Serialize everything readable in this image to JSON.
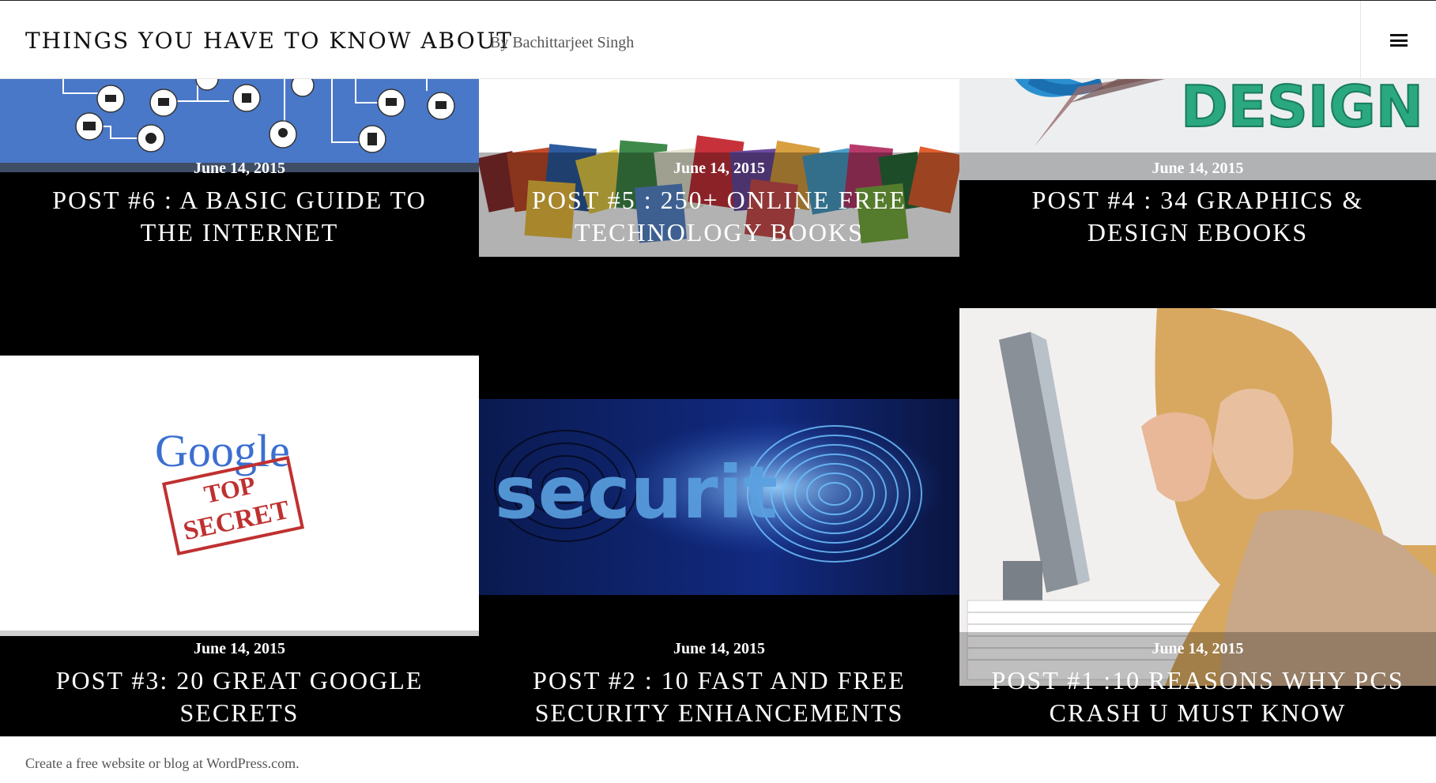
{
  "header": {
    "site_title": "THINGS YOU HAVE TO KNOW ABOUT",
    "site_description": "By Bachittarjeet Singh",
    "menu_icon": "hamburger-menu-icon"
  },
  "posts": [
    {
      "date": "June 14, 2015",
      "title": "POST #6 : A BASIC GUIDE TO THE INTERNET",
      "thumbnail": "internet-devices-illustration"
    },
    {
      "date": "June 14, 2015",
      "title": "POST #5 : 250+ ONLINE FREE TECHNOLOGY BOOKS",
      "thumbnail": "pile-of-books-image"
    },
    {
      "date": "June 14, 2015",
      "title": "POST #4 : 34 GRAPHICS & DESIGN EBOOKS",
      "thumbnail": "3d-design-text-image"
    },
    {
      "date": "June 14, 2015",
      "title": "POST #3: 20 GREAT GOOGLE SECRETS",
      "thumbnail": "google-top-secret-stamp-image"
    },
    {
      "date": "June 14, 2015",
      "title": "POST #2 : 10 FAST AND FREE SECURITY ENHANCEMENTS",
      "thumbnail": "security-fingerprint-image"
    },
    {
      "date": "June 14, 2015",
      "title": "POST #1 :10 REASONS WHY PCS CRASH U MUST KNOW",
      "thumbnail": "frustrated-woman-computer-image"
    }
  ],
  "thumb_text": {
    "design_word": "DESIGN",
    "google_word": "Google",
    "stamp_line1": "TOP",
    "stamp_line2": "SECRET",
    "security_word": "securit"
  },
  "footer": {
    "text": "Create a free website or blog at WordPress.com."
  },
  "colors": {
    "background": "#000000",
    "header_bg": "#ffffff",
    "text_light": "#ffffff",
    "internet_blue": "#4a78c8"
  }
}
